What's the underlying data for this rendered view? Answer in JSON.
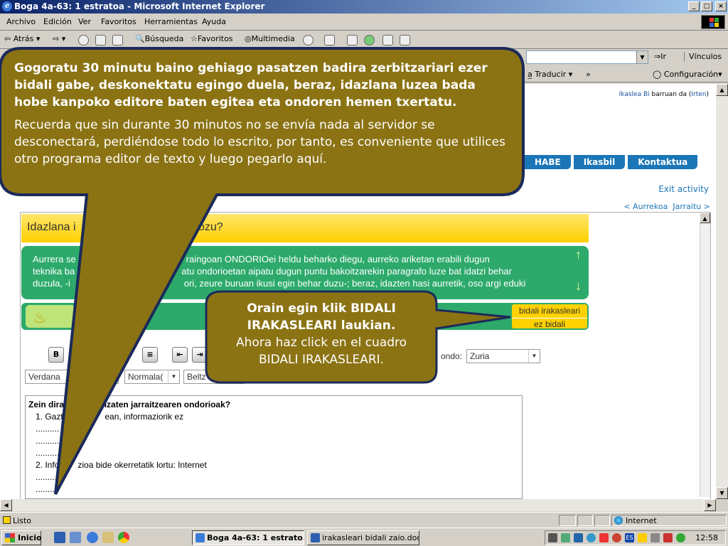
{
  "window": {
    "title": "Boga 4a-63: 1 estratoa - Microsoft Internet Explorer",
    "buttons": {
      "minimize": "_",
      "maximize": "□",
      "close": "×"
    }
  },
  "menu": [
    "Archivo",
    "Edición",
    "Ver",
    "Favoritos",
    "Herramientas",
    "Ayuda"
  ],
  "toolbar": {
    "back": "Atrás",
    "search": "Búsqueda",
    "favorites": "Favoritos",
    "media": "Multimedia"
  },
  "address": {
    "go": "Ir",
    "links": "Vínculos"
  },
  "linksbar": {
    "translate": "Traducir",
    "config": "Configuración"
  },
  "page": {
    "user_name": "Ikaslea Bi",
    "user_text": " barruan da (",
    "logout": "Irten",
    "close_paren": ")",
    "nav": [
      "HABE",
      "Ikasbil",
      "Kontaktua"
    ],
    "exit": "Exit activity",
    "prev": "< Aurrekoa",
    "next": "Jarraitu >",
    "header": "Idazlana i",
    "header_tail": "diozu?",
    "instructions_l1": "Aurrera se",
    "instructions_l1b": "raingoan ONDORIOei heldu beharko diegu, aurreko ariketan erabili dugun",
    "instructions_l2": "teknika ba",
    "instructions_l2b": "atu ondorioetan aipatu dugun puntu bakoitzarekin paragrafo luze bat idatzi behar",
    "instructions_l3": "duzula, -i",
    "instructions_l3b": "ori, zeure buruan ikusi egin behar duzu-; beraz, idazten hasi aurretik, oso argi eduki",
    "send_l1": "bidali irakasleari",
    "send_l2": "ez bidali",
    "font": "Verdana",
    "size": "Normala(",
    "color": "Beltz",
    "bg_label": "ondo:",
    "bg_value": "Zuria",
    "editor": {
      "question_a": "Zein dira s",
      "question_b": "bua izaten jarraitzearen ondorioak?",
      "item1_a": "1. Gazte",
      "item1_b": "ean, informaziorik ez",
      "dots": "..........",
      "item2_a": "2. Infor",
      "item2_b": "zioa bide okerretatik lortu: Internet"
    }
  },
  "callouts": {
    "top_eu": "Gogoratu 30 minutu baino gehiago pasatzen badira zerbitzariari ezer bidali gabe, deskonektatu egingo duela, beraz, idazlana luzea bada hobe kanpoko editore baten egitea eta ondoren hemen txertatu.",
    "top_es": "Recuerda que sin durante 30 minutos no se envía nada al servidor se desconectará, perdiéndose todo lo escrito, por tanto, es conveniente que utilices otro programa editor de texto y luego pegarlo aquí.",
    "mid_eu_1": "Orain egin klik BIDALI",
    "mid_eu_2": "IRAKASLEARI laukian.",
    "mid_es_1": "Ahora haz click en el cuadro",
    "mid_es_2": "BIDALI IRAKASLEARI."
  },
  "status": {
    "text": "Listo",
    "zone": "Internet"
  },
  "taskbar": {
    "start": "Inicio",
    "task1": "Boga 4a-63: 1 estrato...",
    "task2": "irakasleari bidali zaio.doc ...",
    "clock": "12:58"
  },
  "colors": {
    "callout_fill": "#8b7314",
    "callout_border": "#1b2a5a",
    "green": "#2daa6b",
    "yellow": "#ffd000",
    "nav_blue": "#1b76b8"
  }
}
